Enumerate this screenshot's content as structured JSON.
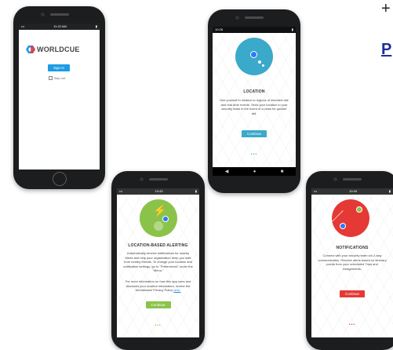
{
  "corner": {
    "plus": "+",
    "letter": "P"
  },
  "signin": {
    "status_time": "11:22 AM",
    "logo_text": "WORLDCUE",
    "logo_mark": "registered-mark",
    "button_label": "Sign In",
    "checkbox_label": "Stay Live"
  },
  "location": {
    "status_time": "10:28",
    "title": "LOCATION",
    "description": "See yourself in relation to regions of elevated risk and real-time events. Send your location to your security team in the event of a crisis for quicker aid.",
    "button_label": "Continue",
    "accent": "#3ba9c9"
  },
  "alerting": {
    "status_time": "10:43",
    "title": "LOCATION-BASED ALERTING",
    "description": "Automatically receive notifications for nearby Alerts and help your organization keep you safe from nearby threats. To change your location and notification settings, go to \"Preferences\" under the \"Menu.\"",
    "description2": "For more information on how this app uses and discloses your location information, review the WorldAware Privacy Policy",
    "policy_link": "here.",
    "button_label": "Continue",
    "accent": "#8bc34a"
  },
  "notifications": {
    "status_time": "10:45",
    "title": "NOTIFICATIONS",
    "description": "Connect with your security team via 2-way communication. Receive alerts based on itinerary points from your scheduled Trips and Assignments.",
    "button_label": "Continue",
    "accent": "#e53935"
  }
}
